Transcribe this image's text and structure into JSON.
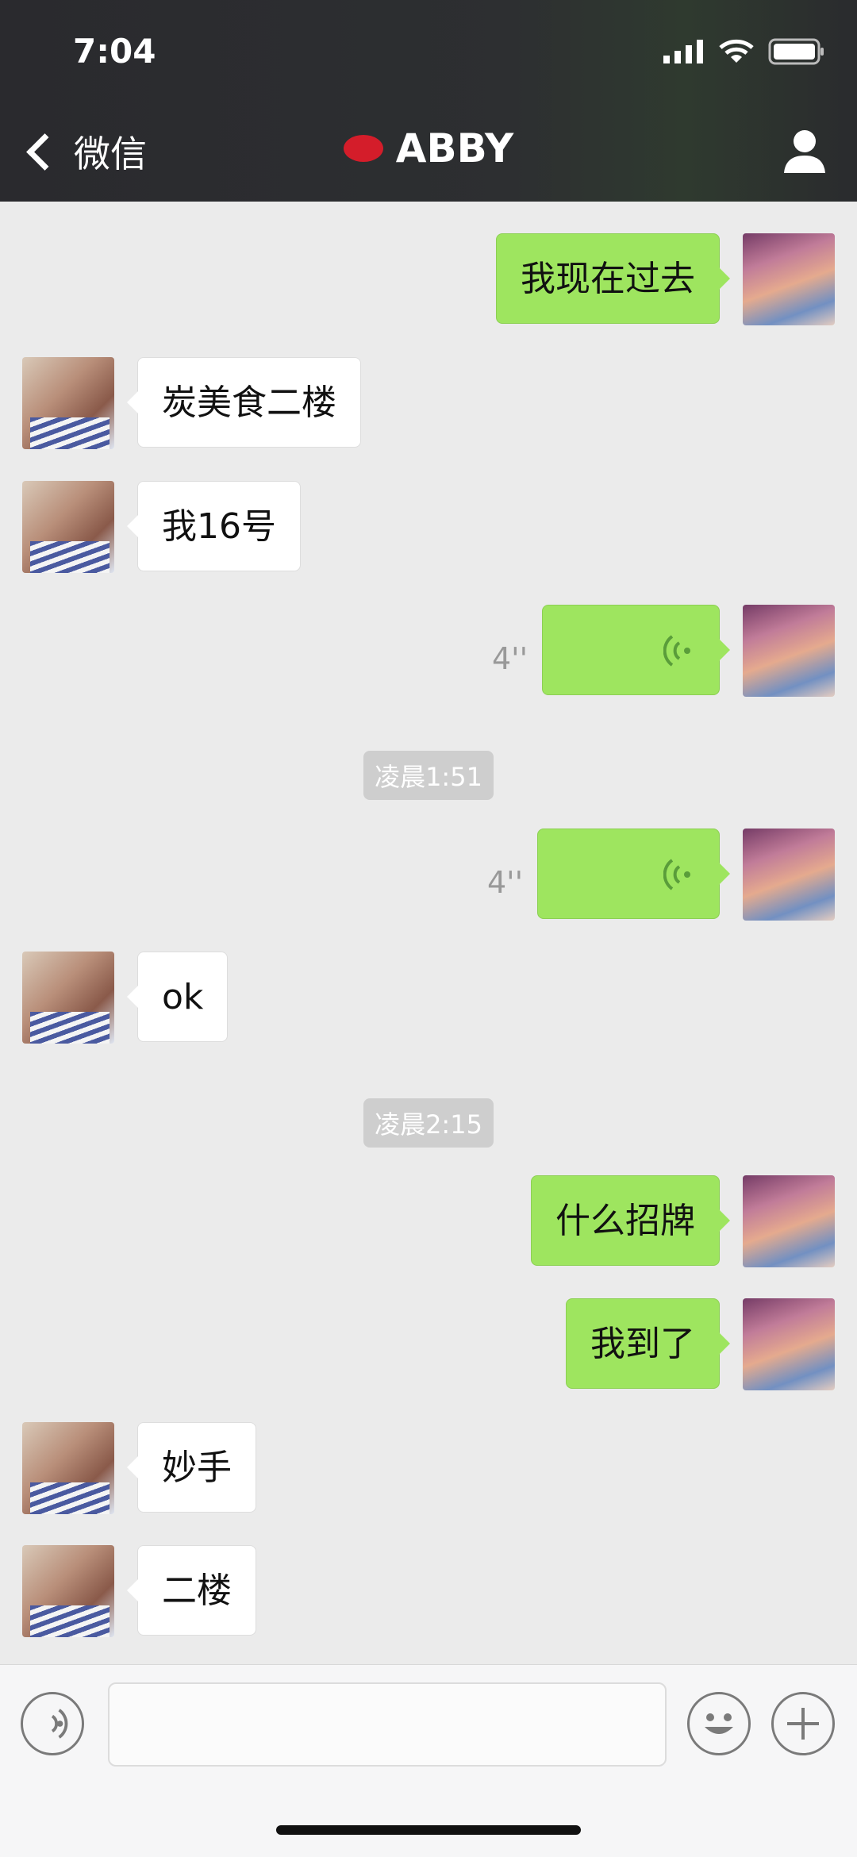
{
  "status_bar": {
    "time": "7:04"
  },
  "nav": {
    "back_label": "微信",
    "title": "ABBY"
  },
  "messages": [
    {
      "side": "right",
      "type": "text",
      "text": "我现在过去"
    },
    {
      "side": "left",
      "type": "text",
      "text": "炭美食二楼"
    },
    {
      "side": "left",
      "type": "text",
      "text": "我16号"
    },
    {
      "side": "right",
      "type": "voice",
      "duration": "4''"
    },
    {
      "type": "timestamp",
      "text": "凌晨1:51"
    },
    {
      "side": "right",
      "type": "voice",
      "duration": "4''"
    },
    {
      "side": "left",
      "type": "text",
      "text": "ok"
    },
    {
      "type": "timestamp",
      "text": "凌晨2:15"
    },
    {
      "side": "right",
      "type": "text",
      "text": "什么招牌"
    },
    {
      "side": "right",
      "type": "text",
      "text": "我到了"
    },
    {
      "side": "left",
      "type": "text",
      "text": "妙手"
    },
    {
      "side": "left",
      "type": "text",
      "text": "二楼"
    }
  ],
  "input_bar": {
    "voice_icon": "voice-mode-icon",
    "emoji_icon": "emoji-icon",
    "plus_icon": "plus-icon"
  },
  "colors": {
    "my_bubble": "#9ee55f",
    "their_bubble": "#ffffff",
    "background": "#ebebeb",
    "header": "#2d2f31"
  }
}
